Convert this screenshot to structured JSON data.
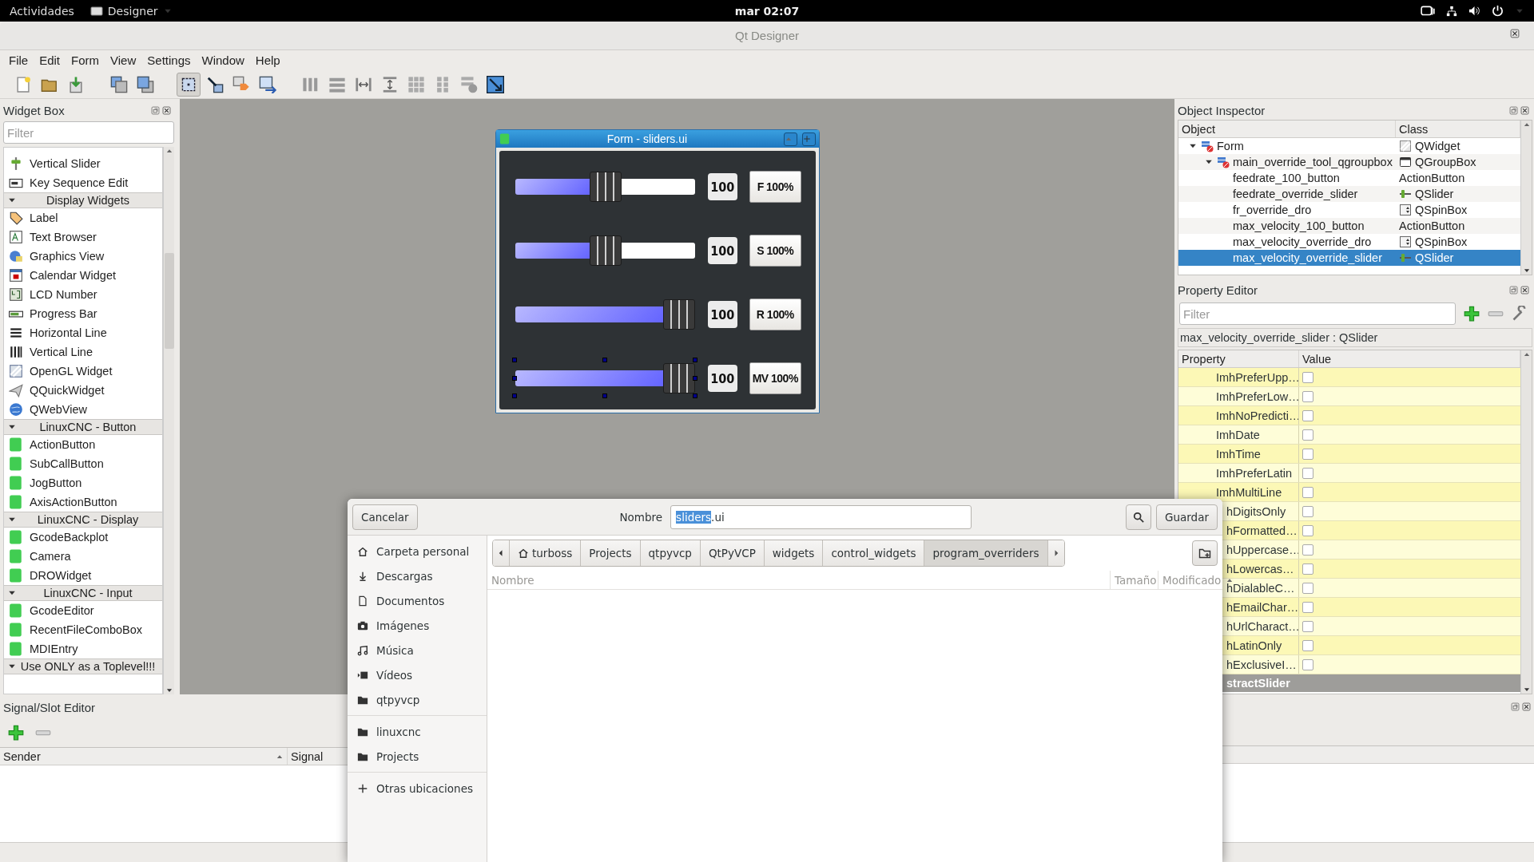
{
  "top_bar": {
    "activities": "Actividades",
    "app_menu": "Designer",
    "clock": "mar 02:07"
  },
  "window": {
    "title": "Qt Designer"
  },
  "menu": [
    "File",
    "Edit",
    "Form",
    "View",
    "Settings",
    "Window",
    "Help"
  ],
  "mode_buttons": [
    {
      "selected": true
    },
    {
      "selected": false
    },
    {
      "selected": false
    },
    {
      "selected": false
    }
  ],
  "widget_box": {
    "title": "Widget Box",
    "filter_placeholder": "Filter",
    "sections": [
      {
        "items": [
          {
            "label": "Vertical Slider",
            "kind": "vslider"
          },
          {
            "label": "Key Sequence Edit",
            "kind": "keyseq"
          }
        ]
      },
      {
        "title": "Display Widgets",
        "expanded": true,
        "items": [
          {
            "label": "Label",
            "kind": "label"
          },
          {
            "label": "Text Browser",
            "kind": "textbrowser"
          },
          {
            "label": "Graphics View",
            "kind": "graphics"
          },
          {
            "label": "Calendar Widget",
            "kind": "calendar"
          },
          {
            "label": "LCD Number",
            "kind": "lcd"
          },
          {
            "label": "Progress Bar",
            "kind": "progress"
          },
          {
            "label": "Horizontal Line",
            "kind": "hline"
          },
          {
            "label": "Vertical Line",
            "kind": "vline"
          },
          {
            "label": "OpenGL Widget",
            "kind": "opengl"
          },
          {
            "label": "QQuickWidget",
            "kind": "quick"
          },
          {
            "label": "QWebView",
            "kind": "web"
          }
        ]
      },
      {
        "title": "LinuxCNC - Button",
        "expanded": true,
        "items": [
          {
            "label": "ActionButton",
            "kind": "qt"
          },
          {
            "label": "SubCallButton",
            "kind": "qt"
          },
          {
            "label": "JogButton",
            "kind": "qt"
          },
          {
            "label": "AxisActionButton",
            "kind": "qt"
          }
        ]
      },
      {
        "title": "LinuxCNC - Display",
        "expanded": true,
        "items": [
          {
            "label": "GcodeBackplot",
            "kind": "qt"
          },
          {
            "label": "Camera",
            "kind": "qt"
          },
          {
            "label": "DROWidget",
            "kind": "qt"
          }
        ]
      },
      {
        "title": "LinuxCNC - Input",
        "expanded": true,
        "items": [
          {
            "label": "GcodeEditor",
            "kind": "qt"
          },
          {
            "label": "RecentFileComboBox",
            "kind": "qt"
          },
          {
            "label": "MDIEntry",
            "kind": "qt"
          }
        ]
      },
      {
        "title": "Use ONLY as a Toplevel!!!",
        "expanded": true
      }
    ]
  },
  "form": {
    "title": "Form - sliders.ui",
    "rows": [
      {
        "level": 0.5,
        "value": "100",
        "button": "F 100%",
        "selected": false
      },
      {
        "level": 0.5,
        "value": "100",
        "button": "S 100%",
        "selected": false
      },
      {
        "level": 1,
        "value": "100",
        "button": "R 100%",
        "selected": false
      },
      {
        "level": 1,
        "value": "100",
        "button": "MV 100%",
        "selected": true
      }
    ]
  },
  "object_inspector": {
    "title": "Object Inspector",
    "columns": [
      "Object",
      "Class"
    ],
    "tree": [
      {
        "name": "Form",
        "class": "QWidget",
        "kind": "widget",
        "expanded": true,
        "selected": false,
        "children": [
          {
            "name": "main_override_tool_qgroupbox",
            "class": "QGroupBox",
            "kind": "groupbox",
            "expanded": true,
            "selected": false,
            "children": [
              {
                "name": "feedrate_100_button",
                "class": "ActionButton",
                "selected": false
              },
              {
                "name": "feedrate_override_slider",
                "class": "QSlider",
                "kind": "slider",
                "selected": false
              },
              {
                "name": "fr_override_dro",
                "class": "QSpinBox",
                "kind": "spinbox",
                "selected": false
              },
              {
                "name": "max_velocity_100_button",
                "class": "ActionButton",
                "selected": false
              },
              {
                "name": "max_velocity_override_dro",
                "class": "QSpinBox",
                "kind": "spinbox",
                "selected": false
              },
              {
                "name": "max_velocity_override_slider",
                "class": "QSlider",
                "kind": "slider",
                "selected": true
              }
            ]
          }
        ]
      }
    ]
  },
  "property_editor": {
    "title": "Property Editor",
    "filter_placeholder": "Filter",
    "object_label": "max_velocity_override_slider : QSlider",
    "columns": [
      "Property",
      "Value"
    ],
    "properties": [
      {
        "name": "ImhPreferUpp…",
        "checked": false
      },
      {
        "name": "ImhPreferLow…",
        "checked": false
      },
      {
        "name": "ImhNoPredicti…",
        "checked": false
      },
      {
        "name": "ImhDate",
        "checked": false
      },
      {
        "name": "ImhTime",
        "checked": false
      },
      {
        "name": "ImhPreferLatin",
        "checked": false
      },
      {
        "name": "ImhMultiLine",
        "checked": false
      }
    ],
    "properties_behind_dialog": [
      {
        "name": "hDigitsOnly",
        "checked": false
      },
      {
        "name": "hFormatted…",
        "checked": false
      },
      {
        "name": "hUppercase…",
        "checked": false
      },
      {
        "name": "hLowercas…",
        "checked": false
      },
      {
        "name": "hDialableC…",
        "checked": false
      },
      {
        "name": "hEmailChar…",
        "checked": false
      },
      {
        "name": "hUrlCharact…",
        "checked": false
      },
      {
        "name": "hLatinOnly",
        "checked": false
      },
      {
        "name": "hExclusiveI…",
        "checked": false
      }
    ],
    "section_behind_dialog": "stractSlider"
  },
  "signal_slot_editor": {
    "title": "Signal/Slot Editor",
    "columns": [
      "Sender",
      "Signal"
    ]
  },
  "save_dialog": {
    "cancel": "Cancelar",
    "name_label": "Nombre",
    "file_name": [
      {
        "text": "sliders",
        "selected": true
      },
      {
        "text": ".ui",
        "selected": false
      }
    ],
    "save": "Guardar",
    "places": [
      [
        {
          "label": "Carpeta personal",
          "kind": "home"
        },
        {
          "label": "Descargas",
          "kind": "download"
        },
        {
          "label": "Documentos",
          "kind": "document"
        },
        {
          "label": "Imágenes",
          "kind": "camera"
        },
        {
          "label": "Música",
          "kind": "music"
        },
        {
          "label": "Vídeos",
          "kind": "video"
        },
        {
          "label": "qtpyvcp",
          "kind": "folder"
        }
      ],
      [
        {
          "label": "linuxcnc",
          "kind": "folder"
        },
        {
          "label": "Projects",
          "kind": "folder"
        }
      ],
      [
        {
          "label": "Otras ubicaciones",
          "kind": "plus"
        }
      ]
    ],
    "path": [
      {
        "label": "turboss",
        "home": true,
        "selected": false
      },
      {
        "label": "Projects",
        "selected": false
      },
      {
        "label": "qtpyvcp",
        "selected": false
      },
      {
        "label": "QtPyVCP",
        "selected": false
      },
      {
        "label": "widgets",
        "selected": false
      },
      {
        "label": "control_widgets",
        "selected": false
      },
      {
        "label": "program_overriders",
        "selected": true
      }
    ],
    "columns": [
      "Nombre",
      "Tamaño",
      "Modificado"
    ]
  }
}
